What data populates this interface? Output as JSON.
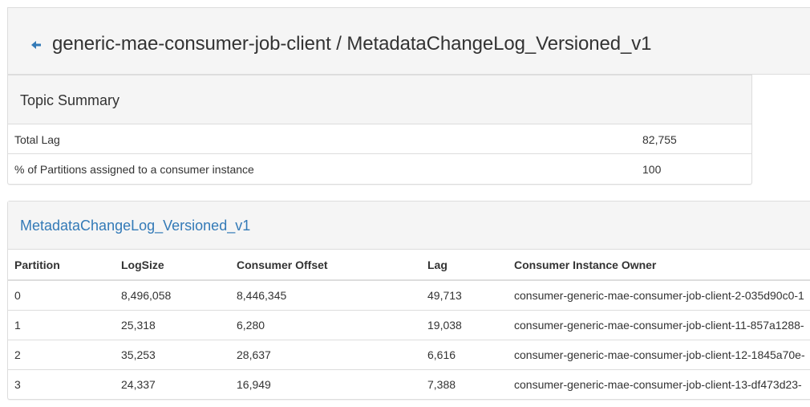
{
  "header": {
    "title": "generic-mae-consumer-job-client / MetadataChangeLog_Versioned_v1",
    "back_icon": "arrow-left-icon",
    "back_color": "#337ab7"
  },
  "summary": {
    "title": "Topic Summary",
    "rows": [
      {
        "label": "Total Lag",
        "value": "82,755"
      },
      {
        "label": "% of Partitions assigned to a consumer instance",
        "value": "100"
      }
    ]
  },
  "partitions": {
    "title": "MetadataChangeLog_Versioned_v1",
    "link_color": "#337ab7",
    "columns": [
      "Partition",
      "LogSize",
      "Consumer Offset",
      "Lag",
      "Consumer Instance Owner"
    ],
    "rows": [
      {
        "partition": "0",
        "log_size": "8,496,058",
        "consumer_offset": "8,446,345",
        "lag": "49,713",
        "owner": "consumer-generic-mae-consumer-job-client-2-035d90c0-1"
      },
      {
        "partition": "1",
        "log_size": "25,318",
        "consumer_offset": "6,280",
        "lag": "19,038",
        "owner": "consumer-generic-mae-consumer-job-client-11-857a1288-"
      },
      {
        "partition": "2",
        "log_size": "35,253",
        "consumer_offset": "28,637",
        "lag": "6,616",
        "owner": "consumer-generic-mae-consumer-job-client-12-1845a70e-"
      },
      {
        "partition": "3",
        "log_size": "24,337",
        "consumer_offset": "16,949",
        "lag": "7,388",
        "owner": "consumer-generic-mae-consumer-job-client-13-df473d23-"
      }
    ]
  }
}
